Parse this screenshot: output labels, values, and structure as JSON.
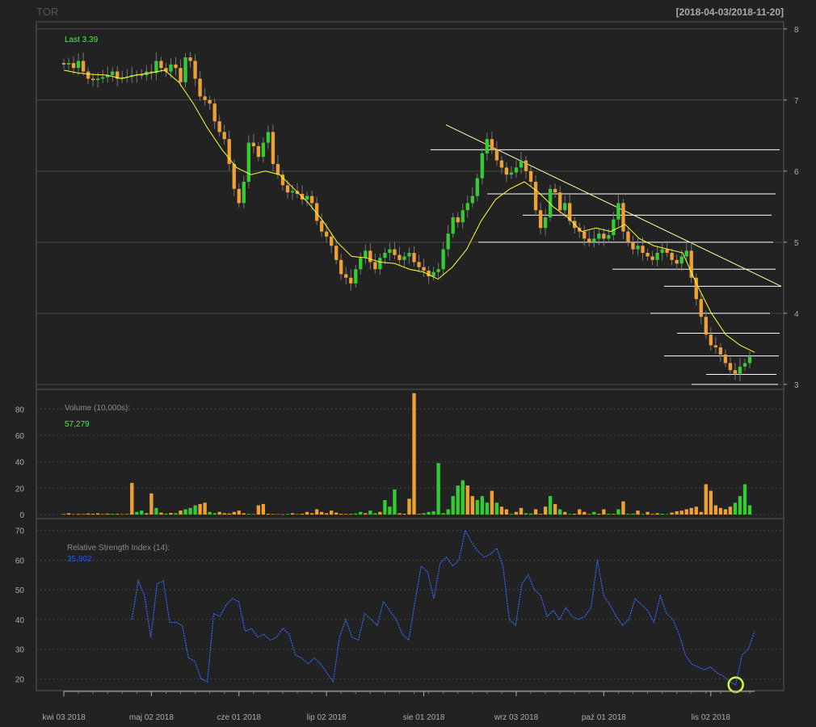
{
  "header": {
    "symbol": "TOR",
    "range": "[2018-04-03/2018-11-20]"
  },
  "colors": {
    "background": "#222222",
    "up": "#33cc33",
    "down": "#f0a030",
    "ma": "#ffff33",
    "rsi": "#3366ff",
    "hline": "#ffffff",
    "trend": "#ffffaa",
    "grid": "#444444",
    "axis": "#aaaaaa",
    "last_label": "#33ff33",
    "marker": "#ccff33"
  },
  "chart_data": [
    {
      "type": "candlestick",
      "name": "price",
      "legend_label": "Last 3.39",
      "ylim": [
        2.93,
        8.1
      ],
      "y_ticks": [
        3,
        4,
        5,
        6,
        7,
        8
      ],
      "values": [
        7.5,
        7.52,
        7.45,
        7.55,
        7.4,
        7.3,
        7.28,
        7.3,
        7.32,
        7.35,
        7.4,
        7.3,
        7.32,
        7.33,
        7.35,
        7.36,
        7.35,
        7.4,
        7.38,
        7.55,
        7.45,
        7.4,
        7.5,
        7.45,
        7.25,
        7.6,
        7.55,
        7.3,
        7.05,
        7.0,
        6.95,
        6.7,
        6.55,
        6.45,
        6.1,
        5.75,
        5.55,
        5.85,
        6.4,
        6.35,
        6.2,
        6.4,
        6.55,
        6.1,
        5.95,
        5.8,
        5.7,
        5.72,
        5.68,
        5.6,
        5.65,
        5.55,
        5.3,
        5.15,
        5.08,
        4.95,
        4.75,
        4.55,
        4.5,
        4.42,
        4.62,
        4.78,
        4.88,
        4.72,
        4.62,
        4.78,
        4.85,
        4.9,
        4.82,
        4.75,
        4.8,
        4.85,
        4.72,
        4.65,
        4.6,
        4.52,
        4.58,
        4.62,
        4.9,
        5.12,
        5.35,
        5.28,
        5.45,
        5.55,
        5.65,
        5.9,
        6.25,
        6.45,
        6.3,
        6.15,
        6.05,
        5.95,
        5.98,
        6.05,
        6.15,
        6.0,
        5.85,
        5.45,
        5.2,
        5.35,
        5.75,
        5.7,
        5.45,
        5.55,
        5.3,
        5.2,
        5.15,
        5.05,
        5.0,
        5.05,
        5.12,
        5.05,
        5.1,
        5.32,
        5.55,
        5.15,
        5.0,
        4.9,
        4.95,
        4.85,
        4.8,
        4.75,
        4.85,
        4.9,
        4.85,
        4.75,
        4.7,
        4.8,
        4.88,
        4.5,
        4.2,
        3.95,
        3.7,
        3.55,
        3.52,
        3.42,
        3.3,
        3.2,
        3.15,
        3.25,
        3.3,
        3.39
      ],
      "ma": [
        7.42,
        7.38,
        7.36,
        7.35,
        7.3,
        7.35,
        7.38,
        7.42,
        7.25,
        6.95,
        6.6,
        6.3,
        6.05,
        5.95,
        6.0,
        5.95,
        5.75,
        5.55,
        5.3,
        5.0,
        4.8,
        4.78,
        4.72,
        4.7,
        4.62,
        4.58,
        4.48,
        4.65,
        4.9,
        5.3,
        5.6,
        5.75,
        5.85,
        5.7,
        5.5,
        5.35,
        5.15,
        5.2,
        5.15,
        5.25,
        5.05,
        4.95,
        4.9,
        4.85,
        4.4,
        4.0,
        3.7,
        3.55,
        3.45
      ],
      "horizontal_levels": [
        6.3,
        5.68,
        5.38,
        5.0,
        4.62,
        4.38,
        4.0,
        3.72,
        3.4,
        3.14,
        3.0
      ],
      "trendline": {
        "from": 6.65,
        "to": 4.38
      }
    },
    {
      "type": "bar",
      "name": "volume",
      "legend_label": "Volume (10,000s):",
      "last_value": "57,279",
      "ylim": [
        0,
        90
      ],
      "y_ticks": [
        0,
        20,
        40,
        60,
        80
      ],
      "values": [
        0.4,
        1,
        0.3,
        0.5,
        0.4,
        0.8,
        0.6,
        0.9,
        0.4,
        0.7,
        0.6,
        0.5,
        0.3,
        0.4,
        24,
        2,
        3,
        1,
        16,
        5,
        1.5,
        0.7,
        1.2,
        1,
        3,
        4,
        5,
        7,
        8,
        9,
        2,
        1,
        2,
        1,
        0.8,
        2,
        3,
        1,
        0.5,
        0.3,
        7,
        8,
        0.6,
        0.4,
        0.3,
        0.2,
        0.5,
        1,
        0.3,
        0.6,
        2,
        1,
        4,
        2,
        1,
        3,
        1.5,
        0.6,
        0.4,
        0.5,
        0.8,
        2,
        1,
        3,
        1,
        2,
        11,
        6,
        19,
        1,
        0.6,
        12,
        92,
        0.5,
        1,
        2,
        2.5,
        39,
        1,
        4,
        14,
        22,
        26,
        22,
        14,
        11,
        14,
        9,
        18,
        9,
        6,
        4,
        0.5,
        2,
        5,
        1,
        0.8,
        4,
        0.5,
        6,
        14,
        8,
        4,
        2,
        0.5,
        0.6,
        4,
        2,
        0.4,
        2,
        0.6,
        4,
        0.6,
        0.5,
        4,
        10,
        0.6,
        0.7,
        3,
        0.4,
        2,
        0.5,
        1,
        0.6,
        0.3,
        1.5,
        2.5,
        3,
        4,
        5,
        6,
        2,
        23,
        18,
        7,
        5,
        4,
        6,
        9,
        14,
        23,
        7
      ],
      "up": [
        false,
        false,
        false,
        false,
        false,
        false,
        false,
        false,
        false,
        false,
        true,
        false,
        false,
        false,
        false,
        true,
        true,
        false,
        false,
        true,
        false,
        true,
        false,
        true,
        false,
        true,
        true,
        true,
        false,
        false,
        true,
        true,
        false,
        false,
        false,
        false,
        false,
        false,
        true,
        false,
        false,
        false,
        false,
        false,
        false,
        false,
        true,
        false,
        false,
        false,
        false,
        false,
        false,
        false,
        false,
        false,
        false,
        false,
        false,
        false,
        true,
        true,
        false,
        true,
        true,
        false,
        true,
        true,
        true,
        false,
        false,
        false,
        false,
        false,
        true,
        true,
        true,
        true,
        true,
        true,
        true,
        true,
        true,
        false,
        false,
        true,
        true,
        true,
        false,
        true,
        false,
        false,
        true,
        false,
        false,
        true,
        true,
        false,
        false,
        false,
        true,
        false,
        true,
        false,
        true,
        false,
        false,
        false,
        false,
        true,
        false,
        false,
        true,
        false,
        true,
        false,
        true,
        true,
        false,
        true,
        false,
        false,
        false,
        true,
        true,
        false,
        false,
        false,
        false,
        false,
        false,
        false,
        false,
        false,
        false,
        false,
        false,
        false,
        true,
        true,
        true,
        true
      ]
    },
    {
      "type": "line",
      "name": "rsi",
      "legend_label": "Relative Strength Index (14):",
      "last_value": "35.902",
      "ylim": [
        16,
        74
      ],
      "y_ticks": [
        20,
        30,
        40,
        50,
        60,
        70
      ],
      "start_index": 14,
      "values": [
        40,
        53,
        48,
        34,
        52,
        53,
        39,
        39,
        38,
        27,
        26,
        20,
        19,
        42,
        41,
        45,
        47,
        46,
        36,
        37,
        34,
        35,
        33,
        34,
        37,
        35,
        28,
        27,
        25,
        27,
        25,
        22,
        19,
        34,
        40,
        34,
        33,
        42,
        40,
        38,
        46,
        43,
        40,
        35,
        33,
        46,
        58,
        56,
        47,
        59,
        61,
        58,
        60,
        70,
        66,
        63,
        61,
        62,
        64,
        58,
        40,
        38,
        52,
        55,
        50,
        48,
        41,
        43,
        40,
        44,
        41,
        40,
        41,
        44,
        60,
        48,
        45,
        41,
        38,
        40,
        47,
        45,
        43,
        39,
        48,
        42,
        40,
        35,
        28,
        25,
        24,
        23,
        24,
        22,
        21,
        19,
        18,
        28,
        30,
        36
      ],
      "marker": {
        "index": 128
      }
    }
  ],
  "x_axis": {
    "n_bars": 143,
    "ticks": [
      {
        "label": "kwi 03 2018",
        "index": 0
      },
      {
        "label": "maj 02 2018",
        "index": 18
      },
      {
        "label": "cze 01 2018",
        "index": 36
      },
      {
        "label": "lip 02 2018",
        "index": 54
      },
      {
        "label": "sie 01 2018",
        "index": 74
      },
      {
        "label": "wrz 03 2018",
        "index": 93
      },
      {
        "label": "paź 01 2018",
        "index": 111
      },
      {
        "label": "lis 02 2018",
        "index": 133
      }
    ]
  }
}
